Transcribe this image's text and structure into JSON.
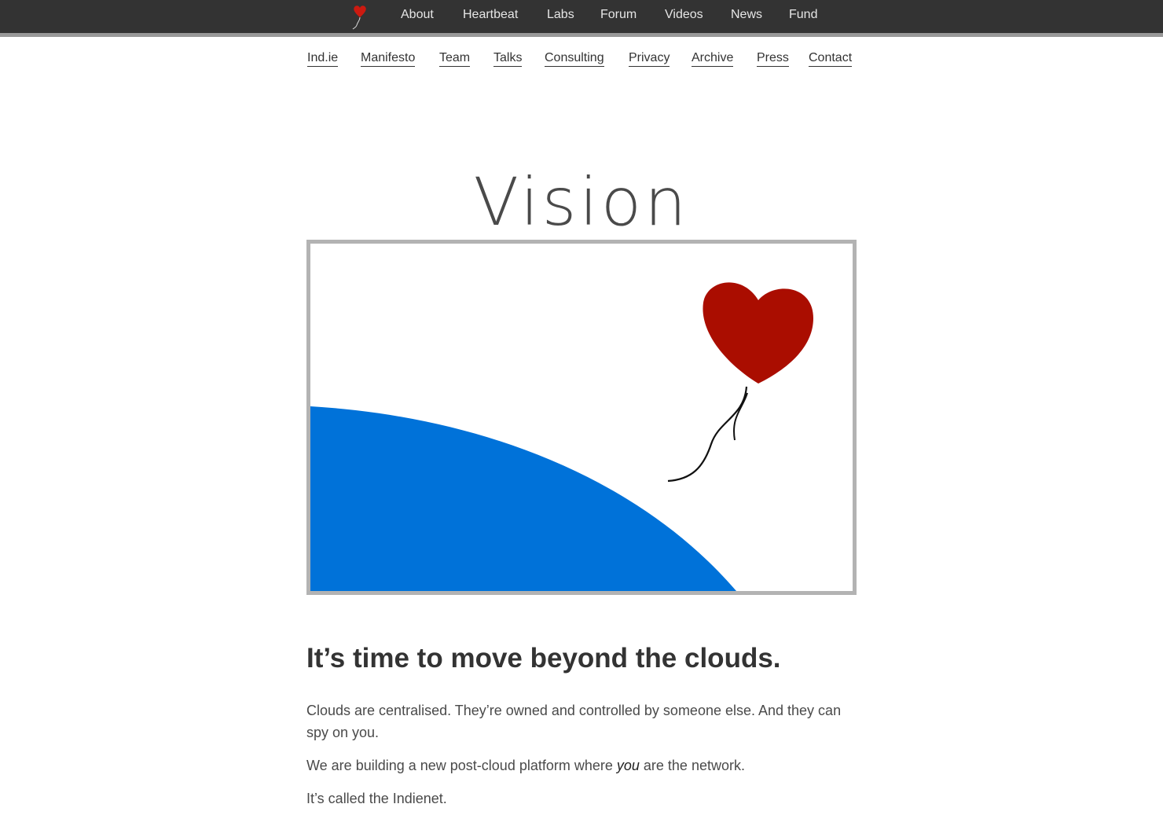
{
  "topnav": {
    "logo_icon": "heart-balloon-icon",
    "items": [
      {
        "label": "About"
      },
      {
        "label": "Heartbeat"
      },
      {
        "label": "Labs"
      },
      {
        "label": "Forum"
      },
      {
        "label": "Videos"
      },
      {
        "label": "News"
      },
      {
        "label": "Fund"
      }
    ]
  },
  "subnav": {
    "items": [
      {
        "label": "Ind.ie"
      },
      {
        "label": "Manifesto"
      },
      {
        "label": "Team"
      },
      {
        "label": "Talks"
      },
      {
        "label": "Consulting"
      },
      {
        "label": "Privacy"
      },
      {
        "label": "Archive"
      },
      {
        "label": "Press"
      },
      {
        "label": "Contact"
      }
    ]
  },
  "page": {
    "title": "Vision",
    "hero_image": "heart-balloon-over-earth-illustration",
    "headline": "It’s time to move beyond the clouds.",
    "paragraph_1": "Clouds are centralised. They’re owned and controlled by someone else. And they can spy on you.",
    "paragraph_2_before": "We are building a new post-cloud platform where ",
    "paragraph_2_emphasis": "you",
    "paragraph_2_after": " are the network.",
    "paragraph_3": "It’s called the Indienet."
  },
  "colors": {
    "topbar": "#333333",
    "topbar_border": "#999999",
    "heart_red": "#aa0d00",
    "earth_blue": "#0072d9",
    "frame_gray": "#b3b3b3"
  }
}
